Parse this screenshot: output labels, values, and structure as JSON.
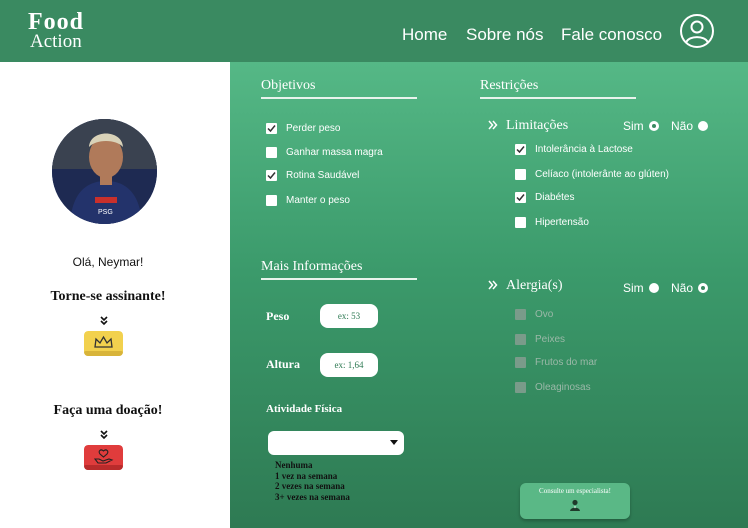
{
  "header": {
    "logo_top": "Food",
    "logo_bottom": "Action",
    "nav": [
      "Home",
      "Sobre nós",
      "Fale conosco"
    ]
  },
  "sidebar": {
    "greeting": "Olá, Neymar!",
    "subscribe_title": "Torne-se assinante!",
    "donate_title": "Faça uma doação!"
  },
  "objectives": {
    "title": "Objetivos",
    "items": [
      {
        "label": "Perder peso",
        "checked": true
      },
      {
        "label": "Ganhar massa magra",
        "checked": false
      },
      {
        "label": "Rotina Saudável",
        "checked": true
      },
      {
        "label": "Manter o peso",
        "checked": false
      }
    ]
  },
  "info": {
    "title": "Mais Informações",
    "weight_label": "Peso",
    "weight_placeholder": "ex: 53",
    "height_label": "Altura",
    "height_placeholder": "ex: 1,64",
    "activity_label": "Atividade Física",
    "activity_options": [
      "Nenhuma",
      "1 vez na semana",
      "2 vezes na semana",
      "3+ vezes na semana"
    ]
  },
  "restrictions": {
    "title": "Restrições",
    "limitations": {
      "title": "Limitações",
      "yes_label": "Sim",
      "no_label": "Não",
      "selected": "Sim",
      "items": [
        {
          "label": "Intolerância à Lactose",
          "checked": true
        },
        {
          "label": "Celíaco (intolerânte ao glúten)",
          "checked": false
        },
        {
          "label": "Diabétes",
          "checked": true
        },
        {
          "label": "Hipertensão",
          "checked": false
        }
      ]
    },
    "allergies": {
      "title": "Alergia(s)",
      "yes_label": "Sim",
      "no_label": "Não",
      "selected": "Não",
      "items": [
        {
          "label": "Ovo",
          "checked": false
        },
        {
          "label": "Peixes",
          "checked": false
        },
        {
          "label": "Frutos do mar",
          "checked": false
        },
        {
          "label": "Oleaginosas",
          "checked": false
        }
      ]
    }
  },
  "consult": {
    "label": "Consulte um especialista!"
  },
  "colors": {
    "brand": "#3a8a61",
    "panel_top": "#55b886",
    "panel_bottom": "#2e7a53",
    "crown_button": "#f2d14e",
    "donate_button": "#e03c3c"
  }
}
